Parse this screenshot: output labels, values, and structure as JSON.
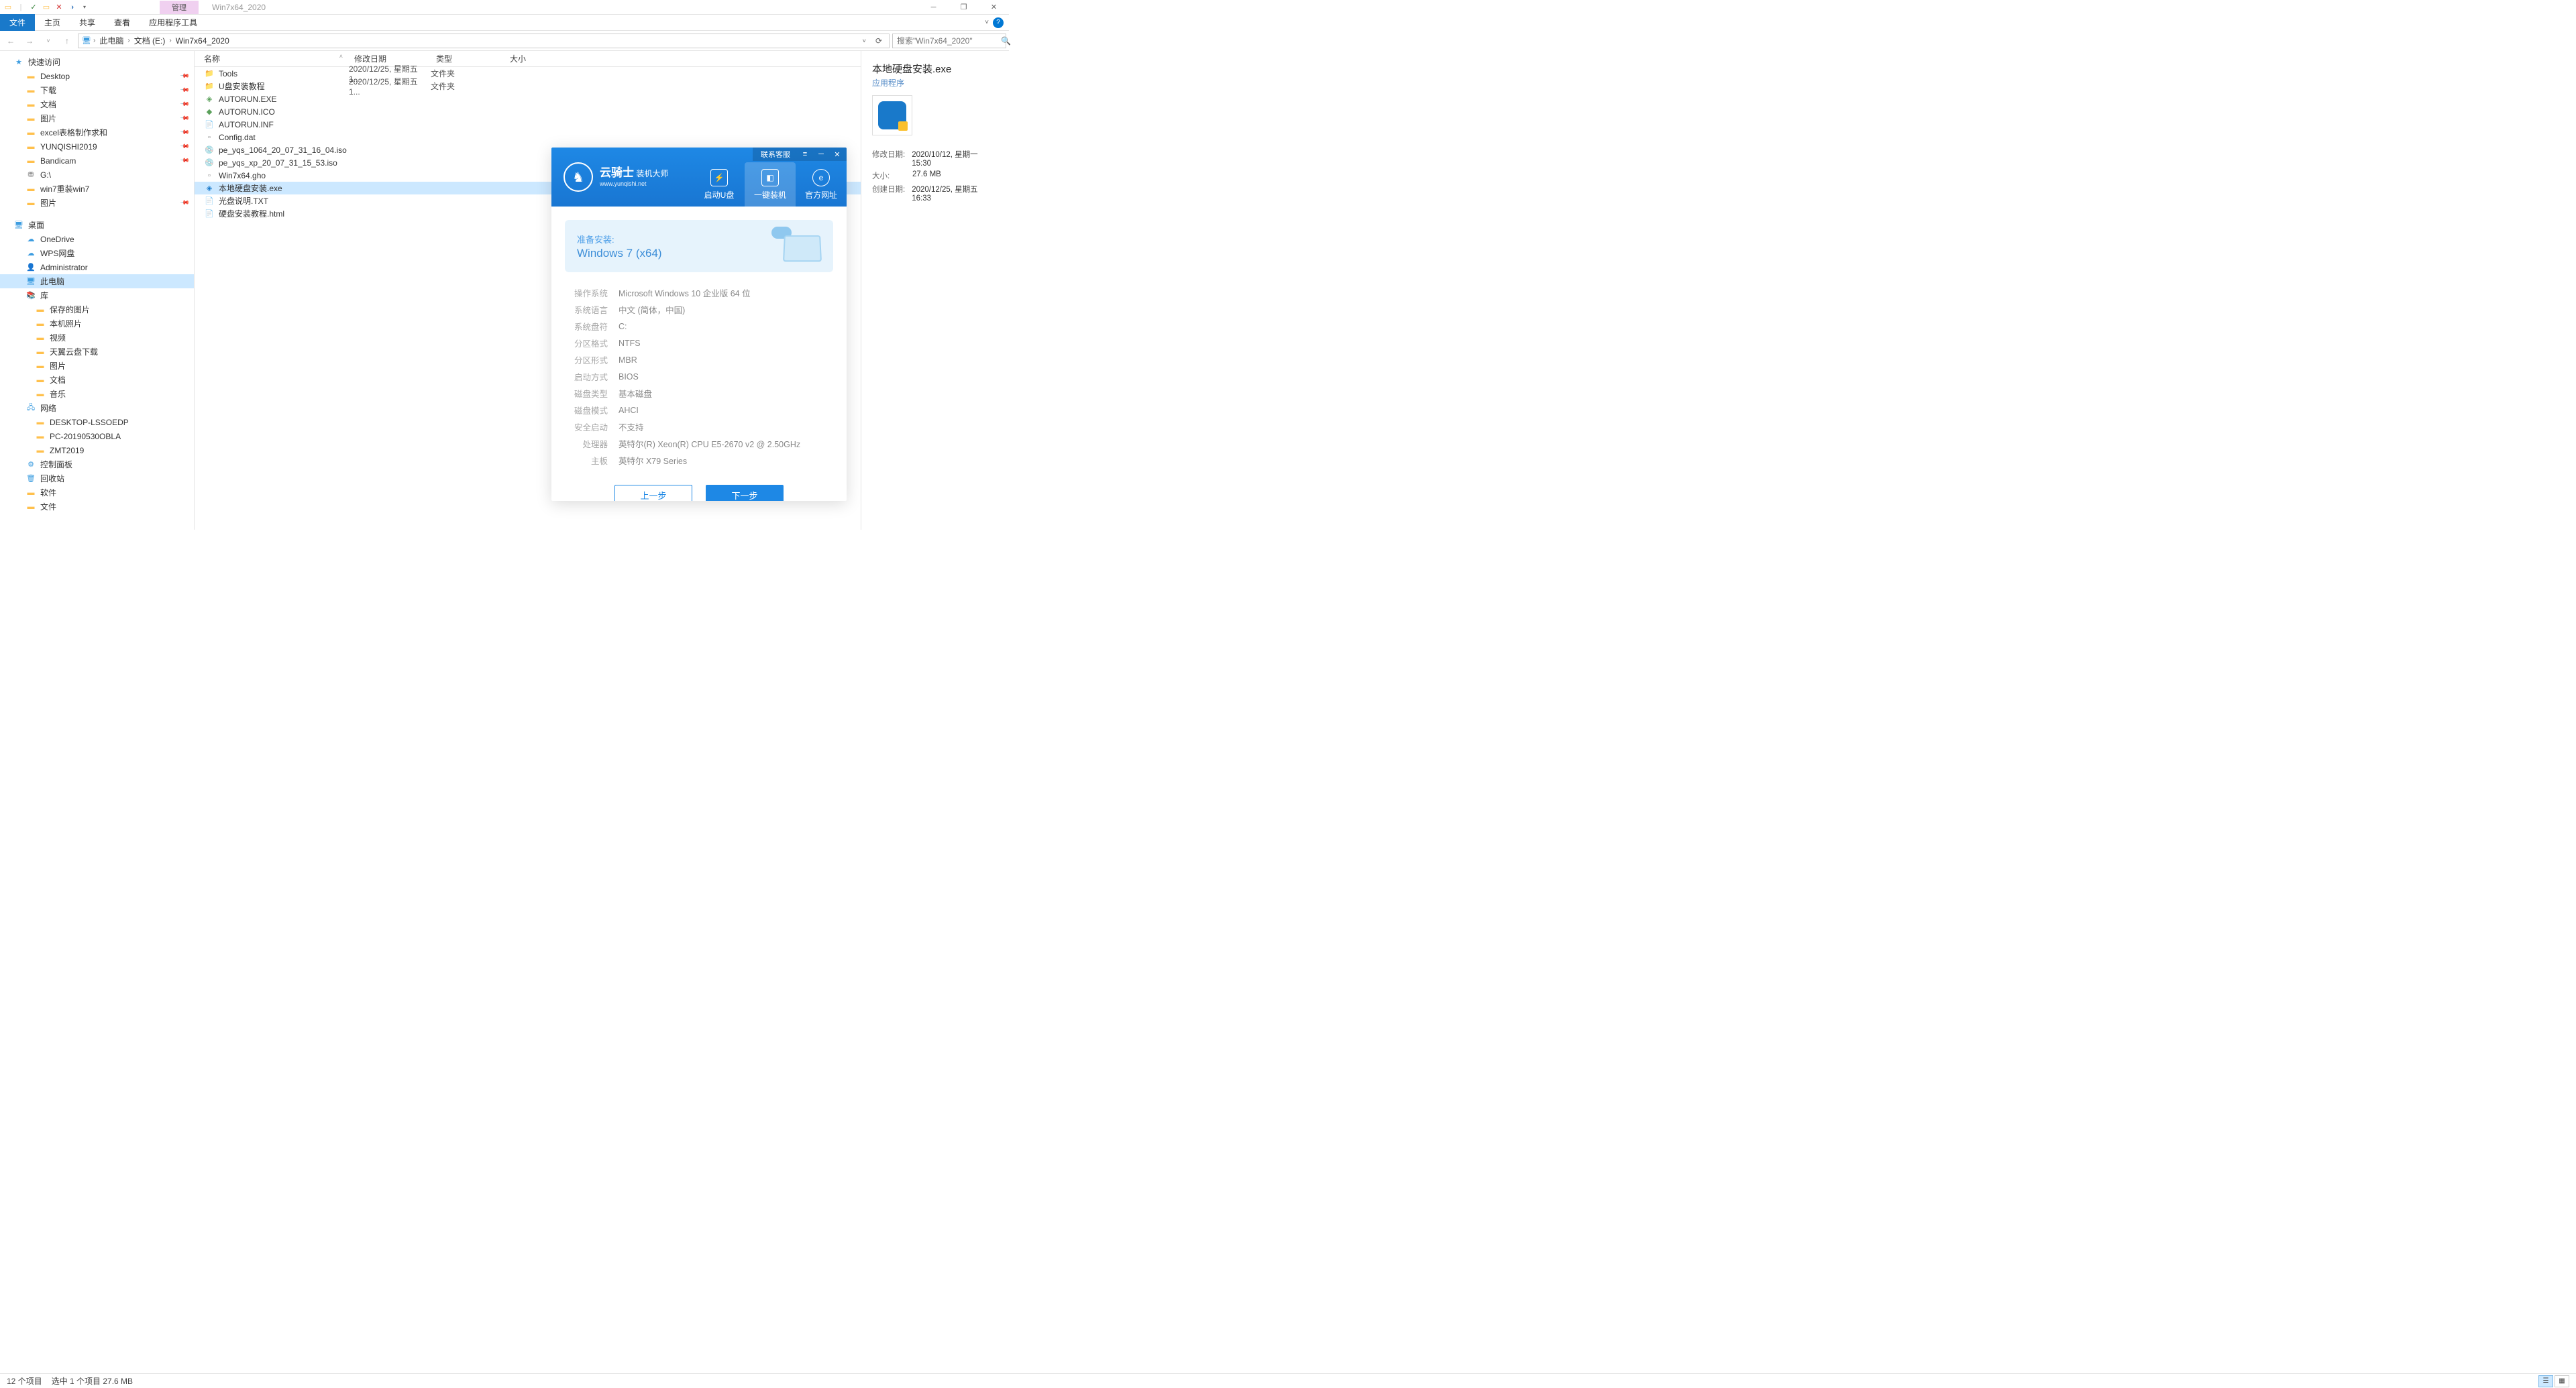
{
  "window": {
    "title": "Win7x64_2020",
    "manage_tab": "管理"
  },
  "ribbon": {
    "file": "文件",
    "home": "主页",
    "share": "共享",
    "view": "查看",
    "apptools": "应用程序工具"
  },
  "breadcrumb": {
    "root": "此电脑",
    "drive": "文档 (E:)",
    "folder": "Win7x64_2020"
  },
  "search": {
    "placeholder": "搜索\"Win7x64_2020\""
  },
  "navtree": {
    "quick": "快速访问",
    "quick_items": [
      "Desktop",
      "下载",
      "文档",
      "图片",
      "excel表格制作求和",
      "YUNQISHI2019",
      "Bandicam",
      "G:\\",
      "win7重装win7",
      "图片"
    ],
    "desktop": "桌面",
    "desktop_items": [
      "OneDrive",
      "WPS网盘",
      "Administrator",
      "此电脑",
      "库",
      "保存的图片",
      "本机照片",
      "视频",
      "天翼云盘下载",
      "图片",
      "文档",
      "音乐",
      "网络",
      "DESKTOP-LSSOEDP",
      "PC-20190530OBLA",
      "ZMT2019",
      "控制面板",
      "回收站",
      "软件",
      "文件"
    ]
  },
  "filehead": {
    "name": "名称",
    "date": "修改日期",
    "type": "类型",
    "size": "大小"
  },
  "files": [
    {
      "name": "Tools",
      "date": "2020/12/25, 星期五 1...",
      "type": "文件夹",
      "icon": "folder"
    },
    {
      "name": "U盘安装教程",
      "date": "2020/12/25, 星期五 1...",
      "type": "文件夹",
      "icon": "folder"
    },
    {
      "name": "AUTORUN.EXE",
      "date": "",
      "type": "",
      "icon": "exe-g"
    },
    {
      "name": "AUTORUN.ICO",
      "date": "",
      "type": "",
      "icon": "ico"
    },
    {
      "name": "AUTORUN.INF",
      "date": "",
      "type": "",
      "icon": "txt"
    },
    {
      "name": "Config.dat",
      "date": "",
      "type": "",
      "icon": "dat"
    },
    {
      "name": "pe_yqs_1064_20_07_31_16_04.iso",
      "date": "",
      "type": "",
      "icon": "iso"
    },
    {
      "name": "pe_yqs_xp_20_07_31_15_53.iso",
      "date": "",
      "type": "",
      "icon": "iso"
    },
    {
      "name": "Win7x64.gho",
      "date": "",
      "type": "",
      "icon": "gho"
    },
    {
      "name": "本地硬盘安装.exe",
      "date": "",
      "type": "",
      "icon": "exe",
      "selected": true
    },
    {
      "name": "光盘说明.TXT",
      "date": "",
      "type": "",
      "icon": "txt"
    },
    {
      "name": "硬盘安装教程.html",
      "date": "",
      "type": "",
      "icon": "html"
    }
  ],
  "details": {
    "title": "本地硬盘安装.exe",
    "subtitle": "应用程序",
    "rows": [
      {
        "label": "修改日期:",
        "value": "2020/10/12, 星期一 15:30"
      },
      {
        "label": "大小:",
        "value": "27.6 MB"
      },
      {
        "label": "创建日期:",
        "value": "2020/12/25, 星期五 16:33"
      }
    ]
  },
  "status": {
    "count": "12 个项目",
    "selected": "选中 1 个项目  27.6 MB"
  },
  "dialog": {
    "brand_cn": "云骑士",
    "brand_suf": "装机大师",
    "brand_url": "www.yunqishi.net",
    "title_contact": "联系客服",
    "nav": [
      "启动U盘",
      "一键装机",
      "官方网址"
    ],
    "banner_label": "准备安装:",
    "banner_os": "Windows 7 (x64)",
    "info": [
      {
        "label": "操作系统",
        "value": "Microsoft Windows 10 企业版 64 位"
      },
      {
        "label": "系统语言",
        "value": "中文 (简体，中国)"
      },
      {
        "label": "系统盘符",
        "value": "C:"
      },
      {
        "label": "分区格式",
        "value": "NTFS"
      },
      {
        "label": "分区形式",
        "value": "MBR"
      },
      {
        "label": "启动方式",
        "value": "BIOS"
      },
      {
        "label": "磁盘类型",
        "value": "基本磁盘"
      },
      {
        "label": "磁盘模式",
        "value": "AHCI"
      },
      {
        "label": "安全启动",
        "value": "不支持"
      },
      {
        "label": "处理器",
        "value": "英特尔(R) Xeon(R) CPU E5-2670 v2 @ 2.50GHz"
      },
      {
        "label": "主板",
        "value": "英特尔 X79 Series"
      }
    ],
    "btn_prev": "上一步",
    "btn_next": "下一步"
  }
}
